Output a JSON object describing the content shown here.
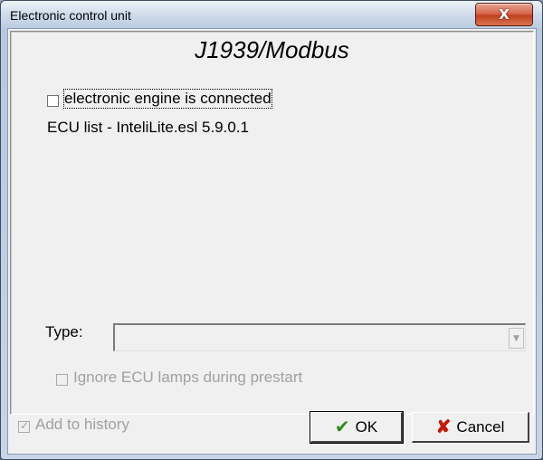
{
  "window": {
    "title": "Electronic control unit",
    "close_glyph": "X"
  },
  "panel": {
    "protocol_title": "J1939/Modbus",
    "engine_connected_label": "electronic engine is connected",
    "engine_connected_checked": false,
    "ecu_list_text": "ECU list - InteliLite.esl 5.9.0.1",
    "type_label": "Type:",
    "type_value": "",
    "ignore_lamps_label": "Ignore ECU lamps during prestart",
    "ignore_lamps_checked": false
  },
  "footer": {
    "add_history_label": "Add to history",
    "add_history_checked": true,
    "ok_label": "OK",
    "cancel_label": "Cancel"
  },
  "icons": {
    "ok": "check-icon",
    "cancel": "cross-icon",
    "ok_color": "#2e8b1e",
    "cancel_color": "#c41a0a"
  }
}
